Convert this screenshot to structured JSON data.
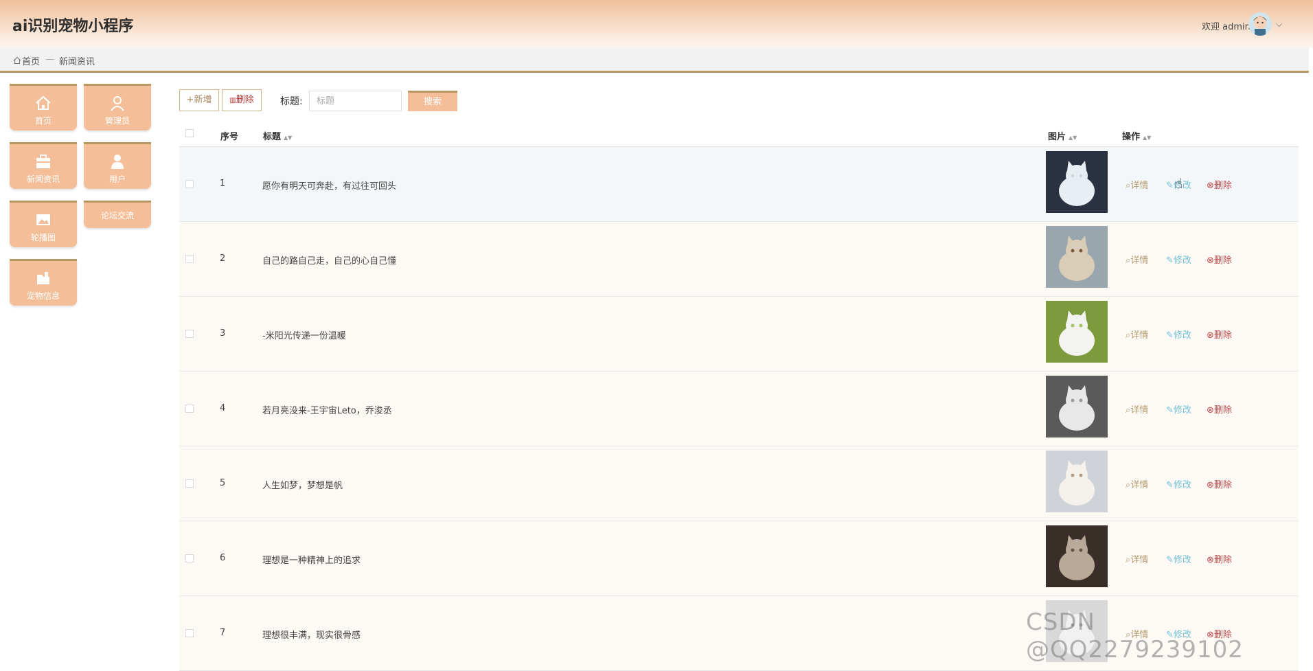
{
  "header": {
    "app_title": "ai识别宠物小程序",
    "welcome": "欢迎 admin",
    "chevron": "⌵"
  },
  "breadcrumb": {
    "home": "首页",
    "separator": "—",
    "current": "新闻资讯"
  },
  "sidebar": {
    "items": [
      {
        "label": "首页",
        "icon": "home-icon"
      },
      {
        "label": "管理员",
        "icon": "user-icon"
      },
      {
        "label": "新闻资讯",
        "icon": "briefcase-icon"
      },
      {
        "label": "用户",
        "icon": "person-icon"
      },
      {
        "label": "轮播图",
        "icon": "image-icon"
      },
      {
        "label": "论坛交流",
        "icon": ""
      },
      {
        "label": "宠物信息",
        "icon": "folder-icon"
      }
    ]
  },
  "toolbar": {
    "add_label": "+新增",
    "delete_label": "删除",
    "title_label": "标题:",
    "search_placeholder": "标题",
    "search_label": "搜索"
  },
  "table": {
    "headers": {
      "index": "序号",
      "title": "标题",
      "image": "图片",
      "actions": "操作"
    },
    "rows": [
      {
        "index": "1",
        "title": "愿你有明天可奔赴，有过往可回头"
      },
      {
        "index": "2",
        "title": "自己的路自己走，自己的心自己懂"
      },
      {
        "index": "3",
        "title": "-米阳光传递一份温暖"
      },
      {
        "index": "4",
        "title": "若月亮没来-王宇宙Leto，乔浚丞"
      },
      {
        "index": "5",
        "title": "人生如梦，梦想是帆"
      },
      {
        "index": "6",
        "title": "理想是一种精神上的追求"
      },
      {
        "index": "7",
        "title": "理想很丰满，现实很骨感"
      }
    ],
    "actions": {
      "view": "详情",
      "edit": "修改",
      "remove": "删除"
    }
  },
  "watermark": "CSDN @QQ2279239102",
  "colors": {
    "accent": "#f4bf98",
    "border": "#b89860",
    "edit": "#73c3d6",
    "delete": "#c04a4a"
  }
}
